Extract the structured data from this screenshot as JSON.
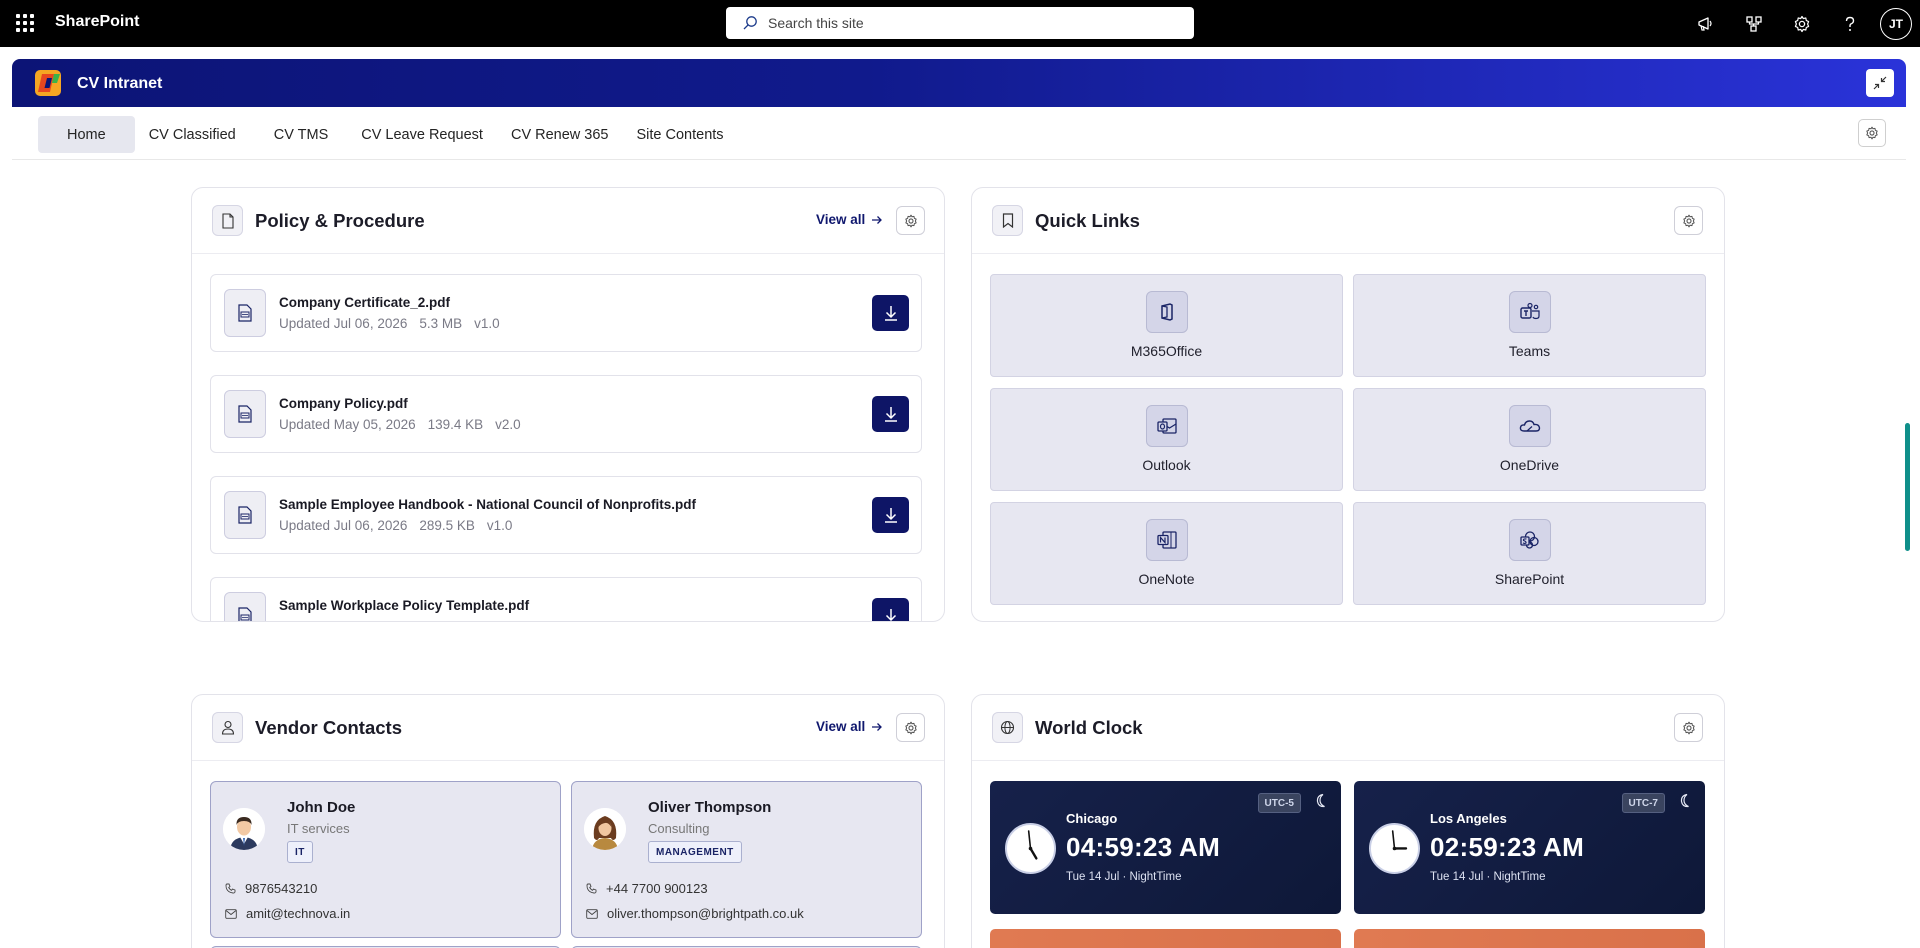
{
  "topbar": {
    "app_name": "SharePoint",
    "search_placeholder": "Search this site",
    "user_initials": "JT"
  },
  "site": {
    "title": "CV Intranet"
  },
  "nav": {
    "items": [
      {
        "label": "Home"
      },
      {
        "label": "CV Classified"
      },
      {
        "label": "CV TMS"
      },
      {
        "label": "CV Leave Request"
      },
      {
        "label": "CV Renew 365"
      },
      {
        "label": "Site Contents"
      }
    ]
  },
  "policy": {
    "title": "Policy & Procedure",
    "view_all": "View all",
    "documents": [
      {
        "name": "Company Certificate_2.pdf",
        "updated": "Updated Jul 06, 2026",
        "size": "5.3 MB",
        "version": "v1.0"
      },
      {
        "name": "Company Policy.pdf",
        "updated": "Updated May 05, 2026",
        "size": "139.4 KB",
        "version": "v2.0"
      },
      {
        "name": "Sample Employee Handbook - National Council of Nonprofits.pdf",
        "updated": "Updated Jul 06, 2026",
        "size": "289.5 KB",
        "version": "v1.0"
      },
      {
        "name": "Sample Workplace Policy Template.pdf",
        "updated": "",
        "size": "",
        "version": ""
      }
    ]
  },
  "quick_links": {
    "title": "Quick Links",
    "links": [
      {
        "label": "M365Office",
        "icon": "office-icon"
      },
      {
        "label": "Teams",
        "icon": "teams-icon"
      },
      {
        "label": "Outlook",
        "icon": "outlook-icon"
      },
      {
        "label": "OneDrive",
        "icon": "onedrive-icon"
      },
      {
        "label": "OneNote",
        "icon": "onenote-icon"
      },
      {
        "label": "SharePoint",
        "icon": "sharepoint-icon"
      }
    ]
  },
  "vendors": {
    "title": "Vendor Contacts",
    "view_all": "View all",
    "contacts": [
      {
        "name": "John Doe",
        "role": "IT services",
        "tag": "IT",
        "phone": "9876543210",
        "email": "amit@technova.in"
      },
      {
        "name": "Oliver Thompson",
        "role": "Consulting",
        "tag": "MANAGEMENT",
        "phone": "+44 7700 900123",
        "email": "oliver.thompson@brightpath.co.uk"
      }
    ]
  },
  "world_clock": {
    "title": "World Clock",
    "clocks": [
      {
        "city": "Chicago",
        "time": "04:59:23 AM",
        "date": "Tue 14 Jul · NightTime",
        "utc": "UTC-5",
        "hour": 4,
        "minute": 59
      },
      {
        "city": "Los Angeles",
        "time": "02:59:23 AM",
        "date": "Tue 14 Jul · NightTime",
        "utc": "UTC-7",
        "hour": 2,
        "minute": 59
      }
    ]
  },
  "colors": {
    "brand_dark": "#0e1566",
    "header_gradient_start": "#0c1476",
    "header_gradient_end": "#2a33d9",
    "clock_night": "#16214a",
    "clock_day": "#e07a52",
    "scroll_accent": "#0f8f8a"
  }
}
